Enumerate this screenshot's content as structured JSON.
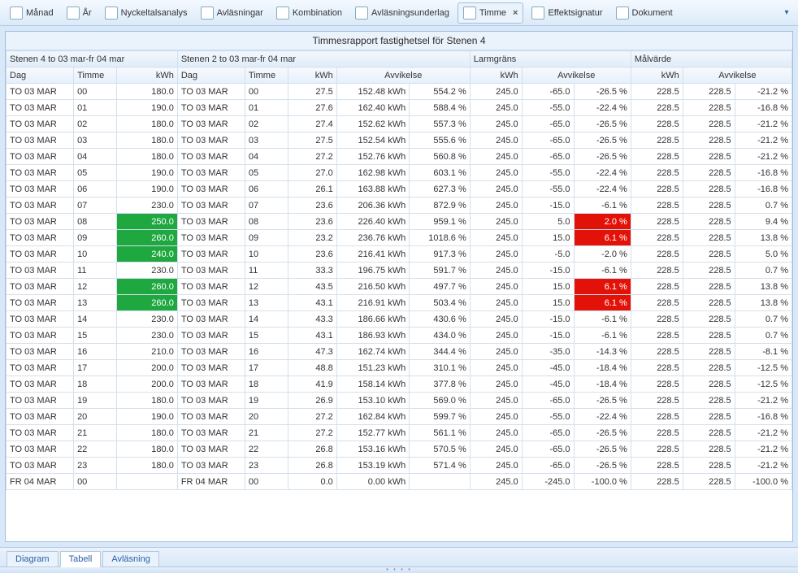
{
  "toolbar": [
    {
      "id": "manad",
      "label": "Månad"
    },
    {
      "id": "ar",
      "label": "År"
    },
    {
      "id": "nyckel",
      "label": "Nyckeltalsanalys"
    },
    {
      "id": "avlas",
      "label": "Avläsningar"
    },
    {
      "id": "komb",
      "label": "Kombination"
    },
    {
      "id": "avlund",
      "label": "Avläsningsunderlag"
    },
    {
      "id": "timme",
      "label": "Timme",
      "active": true,
      "closable": true
    },
    {
      "id": "effekt",
      "label": "Effektsignatur"
    },
    {
      "id": "dok",
      "label": "Dokument"
    }
  ],
  "title": "Timmesrapport fastighetsel för Stenen 4",
  "group_headers": {
    "g1": "Stenen 4 to 03 mar-fr 04 mar",
    "g2": "Stenen 2 to 03 mar-fr 04 mar",
    "g3": "Larmgräns",
    "g4": "Målvärde"
  },
  "col_headers": {
    "dag": "Dag",
    "timme": "Timme",
    "kwh": "kWh",
    "avvik": "Avvikelse"
  },
  "rows": [
    {
      "d1": "TO 03 MAR",
      "t": "00",
      "k1": "180.0",
      "d2": "TO 03 MAR",
      "k2": "27.5",
      "a2a": "152.48 kWh",
      "a2b": "554.2 %",
      "k3": "245.0",
      "a3a": "-65.0",
      "a3b": "-26.5 %",
      "k4": "228.5",
      "a4a": "228.5",
      "a4b": "-21.2 %"
    },
    {
      "d1": "TO 03 MAR",
      "t": "01",
      "k1": "190.0",
      "d2": "TO 03 MAR",
      "k2": "27.6",
      "a2a": "162.40 kWh",
      "a2b": "588.4 %",
      "k3": "245.0",
      "a3a": "-55.0",
      "a3b": "-22.4 %",
      "k4": "228.5",
      "a4a": "228.5",
      "a4b": "-16.8 %"
    },
    {
      "d1": "TO 03 MAR",
      "t": "02",
      "k1": "180.0",
      "d2": "TO 03 MAR",
      "k2": "27.4",
      "a2a": "152.62 kWh",
      "a2b": "557.3 %",
      "k3": "245.0",
      "a3a": "-65.0",
      "a3b": "-26.5 %",
      "k4": "228.5",
      "a4a": "228.5",
      "a4b": "-21.2 %"
    },
    {
      "d1": "TO 03 MAR",
      "t": "03",
      "k1": "180.0",
      "d2": "TO 03 MAR",
      "k2": "27.5",
      "a2a": "152.54 kWh",
      "a2b": "555.6 %",
      "k3": "245.0",
      "a3a": "-65.0",
      "a3b": "-26.5 %",
      "k4": "228.5",
      "a4a": "228.5",
      "a4b": "-21.2 %"
    },
    {
      "d1": "TO 03 MAR",
      "t": "04",
      "k1": "180.0",
      "d2": "TO 03 MAR",
      "k2": "27.2",
      "a2a": "152.76 kWh",
      "a2b": "560.8 %",
      "k3": "245.0",
      "a3a": "-65.0",
      "a3b": "-26.5 %",
      "k4": "228.5",
      "a4a": "228.5",
      "a4b": "-21.2 %"
    },
    {
      "d1": "TO 03 MAR",
      "t": "05",
      "k1": "190.0",
      "d2": "TO 03 MAR",
      "k2": "27.0",
      "a2a": "162.98 kWh",
      "a2b": "603.1 %",
      "k3": "245.0",
      "a3a": "-55.0",
      "a3b": "-22.4 %",
      "k4": "228.5",
      "a4a": "228.5",
      "a4b": "-16.8 %"
    },
    {
      "d1": "TO 03 MAR",
      "t": "06",
      "k1": "190.0",
      "d2": "TO 03 MAR",
      "k2": "26.1",
      "a2a": "163.88 kWh",
      "a2b": "627.3 %",
      "k3": "245.0",
      "a3a": "-55.0",
      "a3b": "-22.4 %",
      "k4": "228.5",
      "a4a": "228.5",
      "a4b": "-16.8 %"
    },
    {
      "d1": "TO 03 MAR",
      "t": "07",
      "k1": "230.0",
      "d2": "TO 03 MAR",
      "k2": "23.6",
      "a2a": "206.36 kWh",
      "a2b": "872.9 %",
      "k3": "245.0",
      "a3a": "-15.0",
      "a3b": "-6.1 %",
      "k4": "228.5",
      "a4a": "228.5",
      "a4b": "0.7 %"
    },
    {
      "d1": "TO 03 MAR",
      "t": "08",
      "k1": "250.0",
      "k1_hl": "green",
      "d2": "TO 03 MAR",
      "k2": "23.6",
      "a2a": "226.40 kWh",
      "a2b": "959.1 %",
      "k3": "245.0",
      "a3a": "5.0",
      "a3b": "2.0 %",
      "a3b_hl": "red",
      "k4": "228.5",
      "a4a": "228.5",
      "a4b": "9.4 %"
    },
    {
      "d1": "TO 03 MAR",
      "t": "09",
      "k1": "260.0",
      "k1_hl": "green",
      "d2": "TO 03 MAR",
      "k2": "23.2",
      "a2a": "236.76 kWh",
      "a2b": "1018.6 %",
      "k3": "245.0",
      "a3a": "15.0",
      "a3b": "6.1 %",
      "a3b_hl": "red",
      "k4": "228.5",
      "a4a": "228.5",
      "a4b": "13.8 %"
    },
    {
      "d1": "TO 03 MAR",
      "t": "10",
      "k1": "240.0",
      "k1_hl": "green",
      "d2": "TO 03 MAR",
      "k2": "23.6",
      "a2a": "216.41 kWh",
      "a2b": "917.3 %",
      "k3": "245.0",
      "a3a": "-5.0",
      "a3b": "-2.0 %",
      "k4": "228.5",
      "a4a": "228.5",
      "a4b": "5.0 %"
    },
    {
      "d1": "TO 03 MAR",
      "t": "11",
      "k1": "230.0",
      "d2": "TO 03 MAR",
      "k2": "33.3",
      "a2a": "196.75 kWh",
      "a2b": "591.7 %",
      "k3": "245.0",
      "a3a": "-15.0",
      "a3b": "-6.1 %",
      "k4": "228.5",
      "a4a": "228.5",
      "a4b": "0.7 %"
    },
    {
      "d1": "TO 03 MAR",
      "t": "12",
      "k1": "260.0",
      "k1_hl": "green",
      "d2": "TO 03 MAR",
      "k2": "43.5",
      "a2a": "216.50 kWh",
      "a2b": "497.7 %",
      "k3": "245.0",
      "a3a": "15.0",
      "a3b": "6.1 %",
      "a3b_hl": "red",
      "k4": "228.5",
      "a4a": "228.5",
      "a4b": "13.8 %"
    },
    {
      "d1": "TO 03 MAR",
      "t": "13",
      "k1": "260.0",
      "k1_hl": "green",
      "d2": "TO 03 MAR",
      "k2": "43.1",
      "a2a": "216.91 kWh",
      "a2b": "503.4 %",
      "k3": "245.0",
      "a3a": "15.0",
      "a3b": "6.1 %",
      "a3b_hl": "red",
      "k4": "228.5",
      "a4a": "228.5",
      "a4b": "13.8 %"
    },
    {
      "d1": "TO 03 MAR",
      "t": "14",
      "k1": "230.0",
      "d2": "TO 03 MAR",
      "k2": "43.3",
      "a2a": "186.66 kWh",
      "a2b": "430.6 %",
      "k3": "245.0",
      "a3a": "-15.0",
      "a3b": "-6.1 %",
      "k4": "228.5",
      "a4a": "228.5",
      "a4b": "0.7 %"
    },
    {
      "d1": "TO 03 MAR",
      "t": "15",
      "k1": "230.0",
      "d2": "TO 03 MAR",
      "k2": "43.1",
      "a2a": "186.93 kWh",
      "a2b": "434.0 %",
      "k3": "245.0",
      "a3a": "-15.0",
      "a3b": "-6.1 %",
      "k4": "228.5",
      "a4a": "228.5",
      "a4b": "0.7 %"
    },
    {
      "d1": "TO 03 MAR",
      "t": "16",
      "k1": "210.0",
      "d2": "TO 03 MAR",
      "k2": "47.3",
      "a2a": "162.74 kWh",
      "a2b": "344.4 %",
      "k3": "245.0",
      "a3a": "-35.0",
      "a3b": "-14.3 %",
      "k4": "228.5",
      "a4a": "228.5",
      "a4b": "-8.1 %"
    },
    {
      "d1": "TO 03 MAR",
      "t": "17",
      "k1": "200.0",
      "d2": "TO 03 MAR",
      "k2": "48.8",
      "a2a": "151.23 kWh",
      "a2b": "310.1 %",
      "k3": "245.0",
      "a3a": "-45.0",
      "a3b": "-18.4 %",
      "k4": "228.5",
      "a4a": "228.5",
      "a4b": "-12.5 %"
    },
    {
      "d1": "TO 03 MAR",
      "t": "18",
      "k1": "200.0",
      "d2": "TO 03 MAR",
      "k2": "41.9",
      "a2a": "158.14 kWh",
      "a2b": "377.8 %",
      "k3": "245.0",
      "a3a": "-45.0",
      "a3b": "-18.4 %",
      "k4": "228.5",
      "a4a": "228.5",
      "a4b": "-12.5 %"
    },
    {
      "d1": "TO 03 MAR",
      "t": "19",
      "k1": "180.0",
      "d2": "TO 03 MAR",
      "k2": "26.9",
      "a2a": "153.10 kWh",
      "a2b": "569.0 %",
      "k3": "245.0",
      "a3a": "-65.0",
      "a3b": "-26.5 %",
      "k4": "228.5",
      "a4a": "228.5",
      "a4b": "-21.2 %"
    },
    {
      "d1": "TO 03 MAR",
      "t": "20",
      "k1": "190.0",
      "d2": "TO 03 MAR",
      "k2": "27.2",
      "a2a": "162.84 kWh",
      "a2b": "599.7 %",
      "k3": "245.0",
      "a3a": "-55.0",
      "a3b": "-22.4 %",
      "k4": "228.5",
      "a4a": "228.5",
      "a4b": "-16.8 %"
    },
    {
      "d1": "TO 03 MAR",
      "t": "21",
      "k1": "180.0",
      "d2": "TO 03 MAR",
      "k2": "27.2",
      "a2a": "152.77 kWh",
      "a2b": "561.1 %",
      "k3": "245.0",
      "a3a": "-65.0",
      "a3b": "-26.5 %",
      "k4": "228.5",
      "a4a": "228.5",
      "a4b": "-21.2 %"
    },
    {
      "d1": "TO 03 MAR",
      "t": "22",
      "k1": "180.0",
      "d2": "TO 03 MAR",
      "k2": "26.8",
      "a2a": "153.16 kWh",
      "a2b": "570.5 %",
      "k3": "245.0",
      "a3a": "-65.0",
      "a3b": "-26.5 %",
      "k4": "228.5",
      "a4a": "228.5",
      "a4b": "-21.2 %"
    },
    {
      "d1": "TO 03 MAR",
      "t": "23",
      "k1": "180.0",
      "d2": "TO 03 MAR",
      "k2": "26.8",
      "a2a": "153.19 kWh",
      "a2b": "571.4 %",
      "k3": "245.0",
      "a3a": "-65.0",
      "a3b": "-26.5 %",
      "k4": "228.5",
      "a4a": "228.5",
      "a4b": "-21.2 %"
    },
    {
      "d1": "FR 04 MAR",
      "t": "00",
      "k1": "",
      "d2": "FR 04 MAR",
      "k2": "0.0",
      "a2a": "0.00 kWh",
      "a2b": "",
      "k3": "245.0",
      "a3a": "-245.0",
      "a3b": "-100.0 %",
      "k4": "228.5",
      "a4a": "228.5",
      "a4b": "-100.0 %"
    }
  ],
  "bottom_tabs": [
    {
      "id": "diagram",
      "label": "Diagram"
    },
    {
      "id": "tabell",
      "label": "Tabell",
      "active": true
    },
    {
      "id": "avlasning",
      "label": "Avläsning"
    }
  ]
}
